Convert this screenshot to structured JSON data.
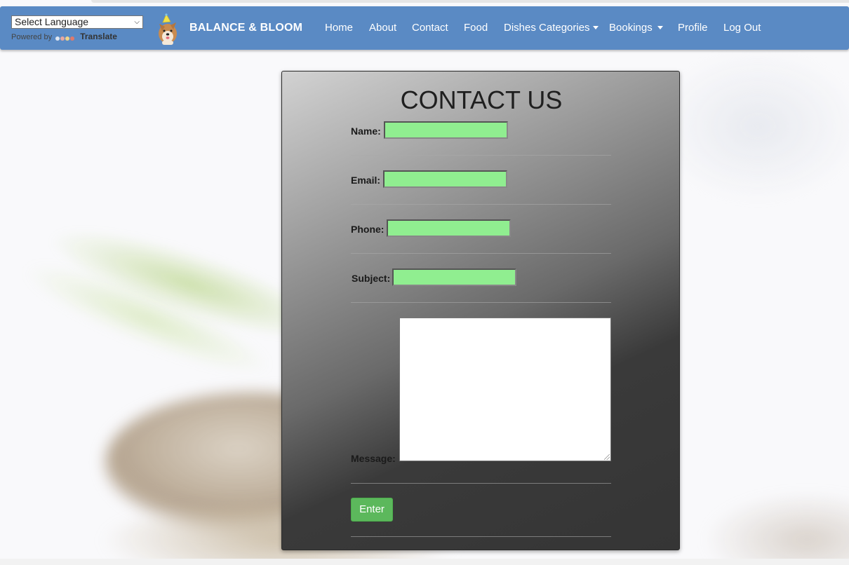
{
  "translate": {
    "select_value": "Select Language",
    "powered_by": "Powered by",
    "translate_label": "Translate"
  },
  "brand": {
    "name": "BALANCE & BLOOM",
    "logo_icon": "dog-party-hat-logo"
  },
  "nav": {
    "items": [
      {
        "label": "Home"
      },
      {
        "label": "About"
      },
      {
        "label": "Contact"
      },
      {
        "label": "Food"
      },
      {
        "label": "Dishes Categories",
        "dropdown": true
      },
      {
        "label": "Bookings",
        "dropdown": true
      },
      {
        "label": "Profile"
      },
      {
        "label": "Log Out"
      }
    ]
  },
  "contact": {
    "title": "CONTACT US",
    "fields": [
      {
        "label": "Name:",
        "value": ""
      },
      {
        "label": "Email:",
        "value": ""
      },
      {
        "label": "Phone:",
        "value": ""
      },
      {
        "label": "Subject:",
        "value": ""
      }
    ],
    "message_label": "Message:",
    "message_value": "",
    "submit_label": "Enter"
  },
  "colors": {
    "navbar": "#5a8ac4",
    "input_fill": "#90ee90",
    "submit_button": "#5cb85c"
  }
}
